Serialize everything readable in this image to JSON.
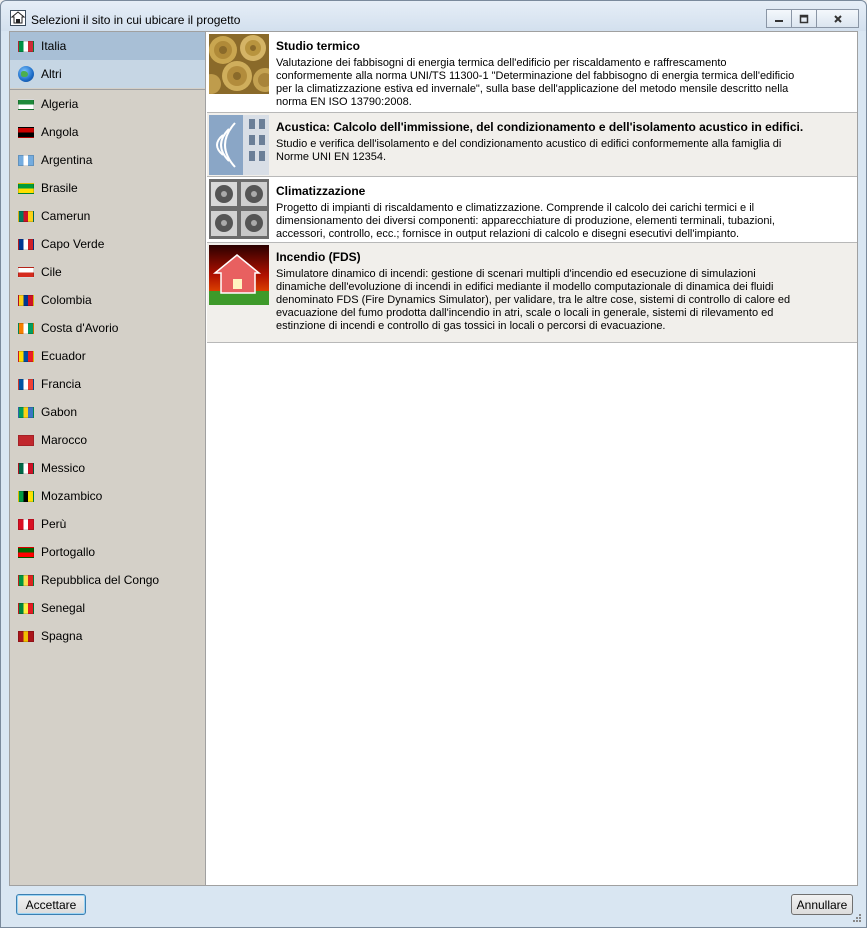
{
  "window": {
    "title": "Selezioni il sito in cui ubicare il progetto",
    "app_icon": "house-logo-icon",
    "controls": [
      "minimize-icon",
      "maximize-icon",
      "close-icon"
    ]
  },
  "sidebar": {
    "selected": "Italia",
    "top_items": [
      {
        "label": "Italia",
        "icon": "flag-italia"
      },
      {
        "label": "Altri",
        "icon": "globe-icon"
      }
    ],
    "items": [
      {
        "label": "Algeria",
        "flag": [
          "#1f8a3a",
          "#ffffff"
        ]
      },
      {
        "label": "Angola",
        "flag": [
          "#cc0000",
          "#000000"
        ]
      },
      {
        "label": "Argentina",
        "flag": [
          "#74acdf",
          "#ffffff",
          "#74acdf"
        ]
      },
      {
        "label": "Brasile",
        "flag": [
          "#009b3a",
          "#fedf00"
        ]
      },
      {
        "label": "Camerun",
        "flag": [
          "#007a5e",
          "#ce1126",
          "#fcd116"
        ]
      },
      {
        "label": "Capo Verde",
        "flag": [
          "#003893",
          "#ffffff",
          "#cf2027"
        ]
      },
      {
        "label": "Cile",
        "flag": [
          "#ffffff",
          "#d52b1e"
        ]
      },
      {
        "label": "Colombia",
        "flag": [
          "#fcd116",
          "#003893",
          "#ce1126"
        ]
      },
      {
        "label": "Costa d'Avorio",
        "flag": [
          "#f77f00",
          "#ffffff",
          "#009e60"
        ]
      },
      {
        "label": "Ecuador",
        "flag": [
          "#ffdd00",
          "#034ea2",
          "#ed1c24"
        ]
      },
      {
        "label": "Francia",
        "flag": [
          "#0055a4",
          "#ffffff",
          "#ef4135"
        ]
      },
      {
        "label": "Gabon",
        "flag": [
          "#009e60",
          "#fcd116",
          "#3a75c4"
        ]
      },
      {
        "label": "Marocco",
        "flag": [
          "#c1272d",
          "#c1272d"
        ]
      },
      {
        "label": "Messico",
        "flag": [
          "#006847",
          "#ffffff",
          "#ce1126"
        ]
      },
      {
        "label": "Mozambico",
        "flag": [
          "#009a44",
          "#000000",
          "#fce100"
        ]
      },
      {
        "label": "Perù",
        "flag": [
          "#d91023",
          "#ffffff",
          "#d91023"
        ]
      },
      {
        "label": "Portogallo",
        "flag": [
          "#006600",
          "#ff0000"
        ]
      },
      {
        "label": "Repubblica del Congo",
        "flag": [
          "#009543",
          "#fbde4a",
          "#dc241f"
        ]
      },
      {
        "label": "Senegal",
        "flag": [
          "#00853f",
          "#fdef42",
          "#e31b23"
        ]
      },
      {
        "label": "Spagna",
        "flag": [
          "#aa151b",
          "#f1bf00",
          "#aa151b"
        ]
      }
    ]
  },
  "modules": [
    {
      "title": "Studio termico",
      "image": "hay-bales-image",
      "description": "Valutazione dei fabbisogni di energia termica dell'edificio per riscaldamento e raffrescamento\nconformemente alla norma UNI/TS 11300-1 \"Determinazione del fabbisogno di energia termica dell'edificio\nper la climatizzazione estiva ed invernale\", sulla base dell'applicazione del metodo mensile descritto nella\nnorma EN ISO 13790:2008."
    },
    {
      "title": "Acustica: Calcolo dell'immissione, del condizionamento e dell'isolamento acustico in edifici.",
      "image": "sound-waves-image",
      "description": "Studio e verifica dell'isolamento e del condizionamento acustico di edifici conformemente alla famiglia di\nNorme UNI EN 12354."
    },
    {
      "title": "Climatizzazione",
      "image": "air-conditioners-image",
      "description": "Progetto di impianti di riscaldamento e climatizzazione. Comprende il calcolo dei carichi termici e il\ndimensionamento dei diversi componenti: apparecchiature di produzione, elementi terminali, tubazioni,\naccessori, controllo, ecc.; fornisce in output relazioni di calcolo e disegni esecutivi dell'impianto."
    },
    {
      "title": "Incendio (FDS)",
      "image": "burning-house-image",
      "description": "Simulatore dinamico di incendi: gestione di scenari multipli d'incendio ed esecuzione di simulazioni\ndinamiche dell'evoluzione di incendi in edifici mediante il modello computazionale di dinamica dei fluidi\ndenominato FDS (Fire Dynamics Simulator), per validare, tra le altre cose, sistemi di controllo di calore ed\nevacuazione del fumo prodotta dall'incendio in atri, scale o locali in generale, sistemi di rilevamento ed\nestinzione di incendi e controllo di gas tossici in locali o percorsi di evacuazione."
    }
  ],
  "footer": {
    "accept_label": "Accettare",
    "cancel_label": "Annullare"
  }
}
